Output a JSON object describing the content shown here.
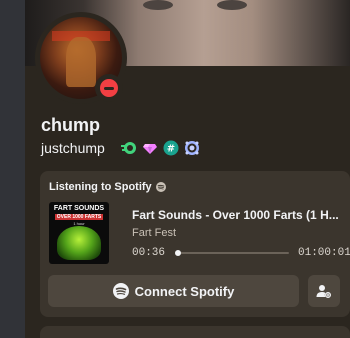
{
  "profile": {
    "display_name": "chump",
    "username": "justchump",
    "status": "dnd",
    "status_color": "#f23f43",
    "badges": [
      "nitro-badge-icon",
      "boost-gem-icon",
      "hashtag-badge-icon",
      "quest-badge-icon"
    ]
  },
  "activity": {
    "header": "Listening to Spotify",
    "album_art": {
      "line1": "FART SOUNDS",
      "line2": "OVER 1000 FARTS",
      "line3": "1 hour"
    },
    "track_title": "Fart Sounds - Over 1000 Farts (1 H...",
    "artist": "Fart Fest",
    "elapsed": "00:36",
    "duration": "01:00:01",
    "progress": 0.01,
    "connect_label": "Connect Spotify"
  },
  "colors": {
    "panel_bg": "#2b261f",
    "card_bg": "#3b352d",
    "button_bg": "#4e473e"
  }
}
